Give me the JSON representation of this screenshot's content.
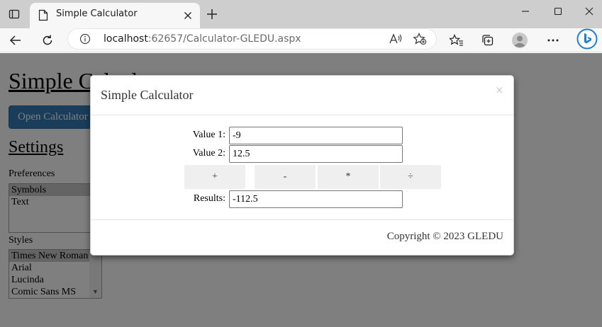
{
  "browser": {
    "tab_title": "Simple Calculator",
    "url_host": "localhost",
    "url_rest": ":62657/Calculator-GLEDU.aspx"
  },
  "page": {
    "heading": "Simple Calculator",
    "open_button": "Open Calculator",
    "settings_heading": "Settings",
    "preferences_label": "Preferences",
    "preferences": [
      "Symbols",
      "Text"
    ],
    "preferences_selected": "Symbols",
    "styles_label": "Styles",
    "styles": [
      "Times New Roman",
      "Arial",
      "Lucinda",
      "Comic Sans MS"
    ],
    "styles_selected": "Times New Roman"
  },
  "modal": {
    "title": "Simple Calculator",
    "close": "×",
    "value1_label": "Value 1:",
    "value1": "-9",
    "value2_label": "Value 2:",
    "value2": "12.5",
    "ops": [
      "+",
      "-",
      "*",
      "÷"
    ],
    "results_label": "Results:",
    "results": "-112.5",
    "copyright": "Copyright © 2023 GLEDU"
  },
  "colors": {
    "primary_button": "#337ab7",
    "overlay": "rgba(0,0,0,0.5)"
  }
}
